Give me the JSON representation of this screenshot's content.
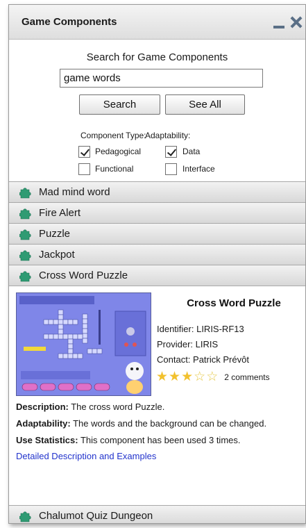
{
  "window": {
    "title": "Game Components"
  },
  "search": {
    "label": "Search for Game Components",
    "value": "game words",
    "search_button": "Search",
    "see_all_button": "See All"
  },
  "filters": {
    "component_type_label": "Component Type:",
    "adaptability_label": "Adaptability:",
    "pedagogical": {
      "label": "Pedagogical",
      "checked": true
    },
    "functional": {
      "label": "Functional",
      "checked": false
    },
    "data": {
      "label": "Data",
      "checked": true
    },
    "interface": {
      "label": "Interface",
      "checked": false
    }
  },
  "components": [
    {
      "label": "Mad mind word"
    },
    {
      "label": "Fire Alert"
    },
    {
      "label": "Puzzle"
    },
    {
      "label": "Jackpot"
    },
    {
      "label": "Cross Word Puzzle",
      "expanded": true
    },
    {
      "label": "Chalumot Quiz Dungeon"
    }
  ],
  "detail": {
    "title": "Cross Word Puzzle",
    "identifier": "Identifier: LIRIS-RF13",
    "provider": "Provider: LIRIS",
    "contact": "Contact: Patrick Prévôt",
    "rating": 3,
    "rating_max": 5,
    "comments": "2 comments",
    "description_label": "Description:",
    "description": " The cross word Puzzle.",
    "adaptability_label": "Adaptability:",
    "adaptability": " The words and the background can be changed.",
    "use_stats_label": "Use Statistics:",
    "use_stats": " This component has been used 3 times.",
    "link": "Detailed Description and Examples"
  },
  "colors": {
    "icon_green": "#2f9b73",
    "link_blue": "#2233cc",
    "screenshot_bg": "#7f86e8"
  }
}
